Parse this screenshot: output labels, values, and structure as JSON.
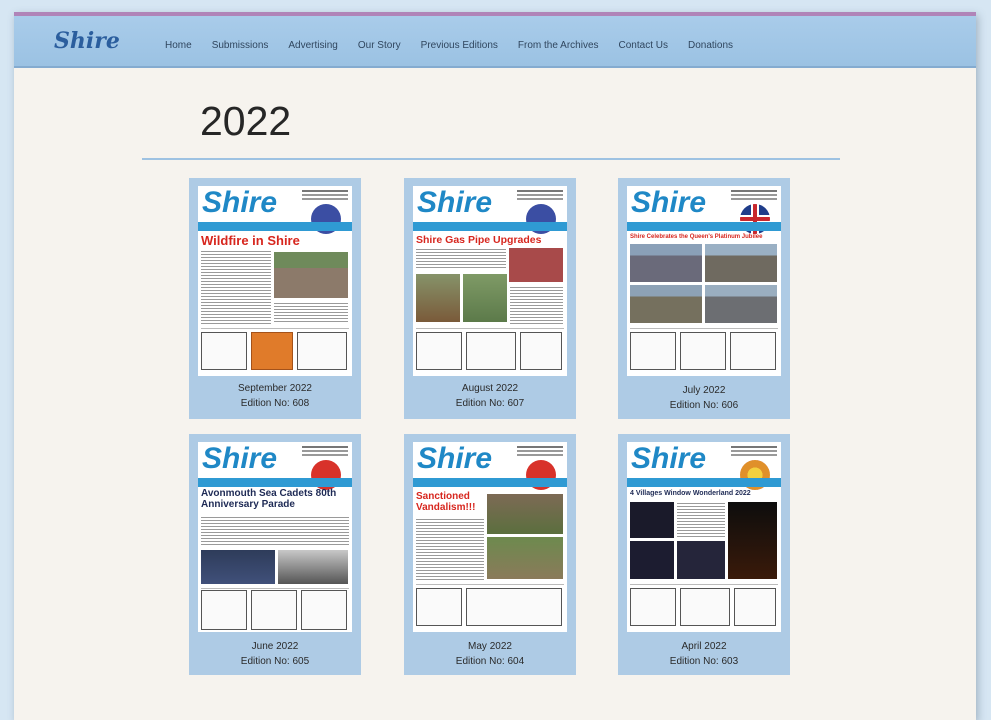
{
  "site": {
    "logo": "Shire"
  },
  "nav": [
    "Home",
    "Submissions",
    "Advertising",
    "Our Story",
    "Previous Editions",
    "From the Archives",
    "Contact Us",
    "Donations"
  ],
  "page": {
    "title": "2022"
  },
  "colors": {
    "accent_bar": "#b084b8",
    "navbar": "#a9ccea",
    "card": "#aecbe5",
    "cover_logo": "#1f88c6",
    "headline": "#d7261e"
  },
  "editions": [
    {
      "cover_logo": "Shire",
      "headline": "Wildfire in Shire",
      "month": "September 2022",
      "edition": "Edition No: 608",
      "badge": "#3b4ea3"
    },
    {
      "cover_logo": "Shire",
      "headline": "Shire Gas Pipe Upgrades",
      "month": "August 2022",
      "edition": "Edition No: 607",
      "badge": "#3b4ea3"
    },
    {
      "cover_logo": "Shire",
      "headline": "Shire Celebrates the Queen's Platinum Jubilee",
      "month": "July 2022",
      "edition": "Edition No: 606",
      "badge": "#c8282e"
    },
    {
      "cover_logo": "Shire",
      "headline": "Avonmouth Sea Cadets 80th Anniversary Parade",
      "month": "June 2022",
      "edition": "Edition No: 605",
      "badge": "#d8322a"
    },
    {
      "cover_logo": "Shire",
      "headline": "Sanctioned Vandalism!!!",
      "month": "May 2022",
      "edition": "Edition No: 604",
      "badge": "#d8322a"
    },
    {
      "cover_logo": "Shire",
      "headline": "4 Villages Window Wonderland 2022",
      "month": "April 2022",
      "edition": "Edition No: 603",
      "badge": "#e0902a"
    }
  ]
}
